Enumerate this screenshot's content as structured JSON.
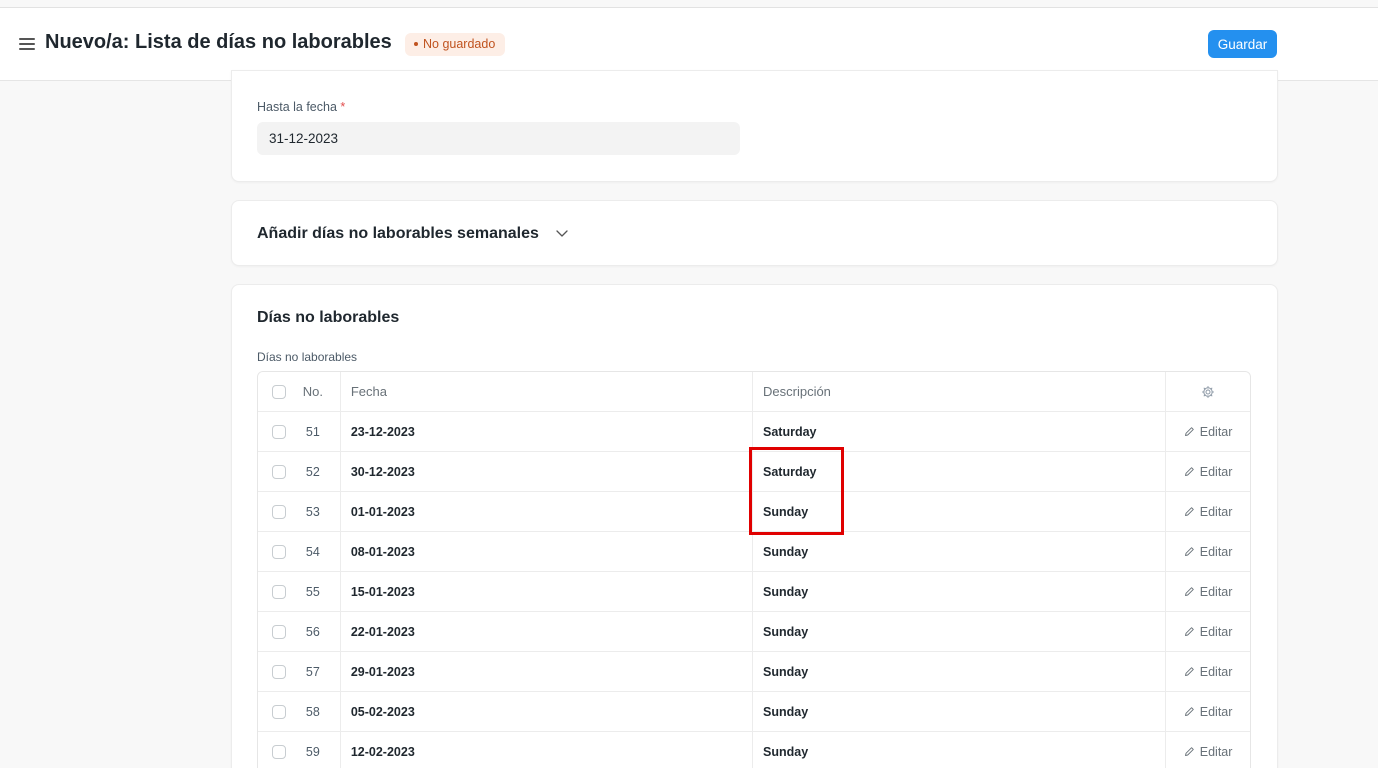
{
  "header": {
    "title": "Nuevo/a: Lista de días no laborables",
    "status_badge": "No guardado",
    "save_label": "Guardar"
  },
  "to_date": {
    "label": "Hasta la fecha",
    "required_mark": "*",
    "value": "31-12-2023"
  },
  "weekly_section": {
    "title": "Añadir días no laborables semanales"
  },
  "holidays_section": {
    "title": "Días no laborables",
    "table_label": "Días no laborables",
    "columns": {
      "no": "No.",
      "date": "Fecha",
      "description": "Descripción"
    },
    "edit_label": "Editar",
    "rows": [
      {
        "no": "51",
        "date": "23-12-2023",
        "description": "Saturday"
      },
      {
        "no": "52",
        "date": "30-12-2023",
        "description": "Saturday"
      },
      {
        "no": "53",
        "date": "01-01-2023",
        "description": "Sunday"
      },
      {
        "no": "54",
        "date": "08-01-2023",
        "description": "Sunday"
      },
      {
        "no": "55",
        "date": "15-01-2023",
        "description": "Sunday"
      },
      {
        "no": "56",
        "date": "22-01-2023",
        "description": "Sunday"
      },
      {
        "no": "57",
        "date": "29-01-2023",
        "description": "Sunday"
      },
      {
        "no": "58",
        "date": "05-02-2023",
        "description": "Sunday"
      },
      {
        "no": "59",
        "date": "12-02-2023",
        "description": "Sunday"
      }
    ]
  },
  "colors": {
    "primary": "#2490ef",
    "badge_bg": "#fdeee6",
    "badge_text": "#c0531f",
    "highlight": "#e00000"
  },
  "icons": {
    "menu": "hamburger-icon",
    "collapse": "chevron-down-icon",
    "settings": "gear-icon",
    "edit": "pencil-icon"
  }
}
